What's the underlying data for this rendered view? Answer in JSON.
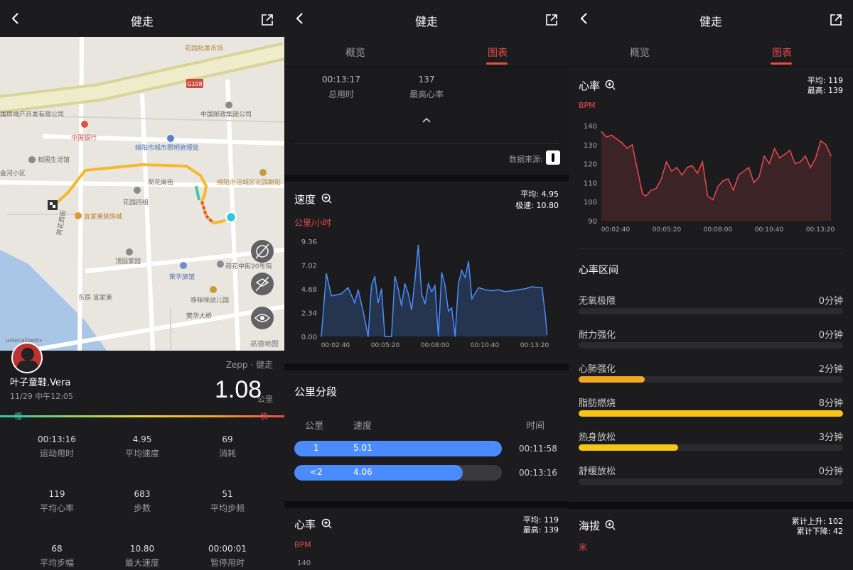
{
  "colors": {
    "accent": "#e84b4b",
    "chart_blue": "#4a8cff",
    "zone_orange": "#f5a623",
    "zone_yellow": "#f5c518",
    "bg": "#1c1c1e"
  },
  "panel1": {
    "title": "健走",
    "map": {
      "labels": [
        "花园批发市场",
        "G108",
        "中国邮政集团公司",
        "绵阳市城市照明管理处",
        "中国银行",
        "相国生活馆",
        "金河小区",
        "荷花南街",
        "绵阳市涪城区花园朝阳",
        "花园四组",
        "宜家美装饰城",
        "荷花西街",
        "顶固家园",
        "荷花中街20号院",
        "荣华旅馆",
        "东辰·宜家美",
        "哆咪咪幼儿园",
        "樊华大桥",
        "unlocalized>",
        "高德地图",
        "国房地产开发有限公司"
      ],
      "icons": [
        "hide-route-icon",
        "map-layer-icon",
        "eye-icon"
      ]
    },
    "user": {
      "name": "叶子童鞋.Vera",
      "datetime": "11/29 中午12:05",
      "source": "Zepp · 健走",
      "distance": "1.08",
      "distance_unit": "公里",
      "slow": "慢",
      "fast": "快"
    },
    "stats": [
      {
        "value": "00:13:16",
        "label": "运动用时"
      },
      {
        "value": "4.95",
        "label": "平均速度"
      },
      {
        "value": "69",
        "label": "消耗"
      },
      {
        "value": "119",
        "label": "平均心率"
      },
      {
        "value": "683",
        "label": "步数"
      },
      {
        "value": "51",
        "label": "平均步频"
      },
      {
        "value": "68",
        "label": "平均步幅"
      },
      {
        "value": "10.80",
        "label": "最大速度"
      },
      {
        "value": "00:00:01",
        "label": "暂停用时"
      }
    ]
  },
  "panel2": {
    "title": "健走",
    "tabs": [
      "概览",
      "图表"
    ],
    "summary": [
      {
        "value": "00:13:17",
        "label": "总用时"
      },
      {
        "value": "137",
        "label": "最高心率"
      }
    ],
    "data_source": "数据来源:",
    "speed": {
      "title": "速度",
      "avg": "平均: 4.95",
      "max": "极速: 10.80",
      "unit": "公里/小时"
    },
    "km": {
      "title": "公里分段",
      "headers": [
        "公里",
        "速度",
        "时间"
      ],
      "rows": [
        {
          "km": "1",
          "speed": "5.01",
          "time": "00:11:58",
          "frac": 1.0
        },
        {
          "km": "<2",
          "speed": "4.06",
          "time": "00:13:16",
          "frac": 0.81
        }
      ]
    },
    "hr": {
      "title": "心率",
      "avg": "平均: 119",
      "max": "最高: 139",
      "unit": "BPM",
      "first_tick": "140"
    }
  },
  "panel3": {
    "title": "健走",
    "tabs": [
      "概览",
      "图表"
    ],
    "hr": {
      "title": "心率",
      "avg": "平均: 119",
      "max": "最高: 139",
      "unit": "BPM"
    },
    "zones_title": "心率区间",
    "zones": [
      {
        "name": "无氧极限",
        "value": "0分钟",
        "frac": 0,
        "color": "#f5c518"
      },
      {
        "name": "耐力强化",
        "value": "0分钟",
        "frac": 0,
        "color": "#f5c518"
      },
      {
        "name": "心肺强化",
        "value": "2分钟",
        "frac": 0.25,
        "color": "#f5a623"
      },
      {
        "name": "脂肪燃烧",
        "value": "8分钟",
        "frac": 1.0,
        "color": "#f5c518"
      },
      {
        "name": "热身放松",
        "value": "3分钟",
        "frac": 0.375,
        "color": "#f5c518"
      },
      {
        "name": "舒缓放松",
        "value": "0分钟",
        "frac": 0,
        "color": "#f5c518"
      }
    ],
    "altitude": {
      "title": "海拔",
      "up": "累计上升: 102",
      "down": "累计下降: 42",
      "unit": "米"
    }
  },
  "chart_data": [
    {
      "type": "line",
      "title": "速度",
      "ylabel": "公里/小时",
      "ylim": [
        0,
        9.36
      ],
      "yticks": [
        "0.00",
        "2.34",
        "4.68",
        "7.02",
        "9.36"
      ],
      "xticks": [
        "00:02:40",
        "00:05:20",
        "00:08:00",
        "00:10:40",
        "00:13:20"
      ],
      "x": [
        0,
        0.3,
        0.6,
        1.2,
        1.6,
        2.0,
        2.2,
        2.5,
        2.8,
        3.0,
        3.2,
        3.4,
        3.6,
        3.8,
        4.0,
        4.2,
        4.4,
        4.6,
        4.8,
        5.0,
        5.2,
        5.4,
        5.6,
        5.8,
        6.0,
        6.2,
        6.4,
        6.6,
        6.8,
        7.0,
        7.2,
        7.4,
        7.6,
        7.8,
        8.0,
        8.2,
        8.4,
        8.6,
        8.8,
        9.0,
        9.4,
        9.8,
        10.2,
        10.6,
        11.0,
        11.4,
        11.8,
        12.2,
        12.6,
        13.0,
        13.2,
        13.4,
        13.5
      ],
      "values": [
        0,
        6.2,
        4.0,
        4.2,
        4.8,
        3.3,
        4.6,
        2.5,
        0,
        5.0,
        5.9,
        3.3,
        4.7,
        0,
        0,
        0,
        5.9,
        4.7,
        3.0,
        5.2,
        4.2,
        2.6,
        5.6,
        9.0,
        4.2,
        3.2,
        5.2,
        4.4,
        5.0,
        0,
        6.3,
        5.0,
        2.5,
        2.8,
        0,
        5.2,
        6.5,
        5.8,
        7.4,
        3.7,
        4.8,
        4.6,
        4.5,
        4.6,
        4.4,
        4.5,
        4.6,
        4.7,
        4.9,
        4.8,
        4.8,
        2.0,
        0.2
      ]
    },
    {
      "type": "line",
      "title": "心率",
      "ylabel": "BPM",
      "ylim": [
        90,
        140
      ],
      "yticks": [
        "90",
        "100",
        "110",
        "120",
        "130",
        "140"
      ],
      "xticks": [
        "00:02:40",
        "00:05:20",
        "00:08:00",
        "00:10:40",
        "00:13:20"
      ],
      "x": [
        0,
        0.3,
        0.6,
        0.9,
        1.2,
        1.5,
        1.8,
        2.1,
        2.4,
        2.6,
        2.9,
        3.2,
        3.5,
        3.8,
        4.1,
        4.4,
        4.7,
        5.0,
        5.3,
        5.6,
        5.9,
        6.2,
        6.5,
        6.8,
        7.1,
        7.4,
        7.7,
        8.0,
        8.3,
        8.6,
        8.9,
        9.2,
        9.5,
        9.8,
        10.1,
        10.4,
        10.7,
        11.0,
        11.3,
        11.6,
        11.9,
        12.2,
        12.5,
        12.8,
        13.1,
        13.4
      ],
      "values": [
        137,
        134,
        135,
        133,
        131,
        128,
        130,
        117,
        104,
        103,
        106,
        107,
        112,
        121,
        116,
        118,
        114,
        118,
        119,
        115,
        121,
        103,
        101,
        108,
        111,
        112,
        106,
        114,
        116,
        118,
        110,
        113,
        124,
        120,
        128,
        123,
        125,
        127,
        120,
        121,
        124,
        118,
        123,
        132,
        130,
        124
      ]
    }
  ]
}
